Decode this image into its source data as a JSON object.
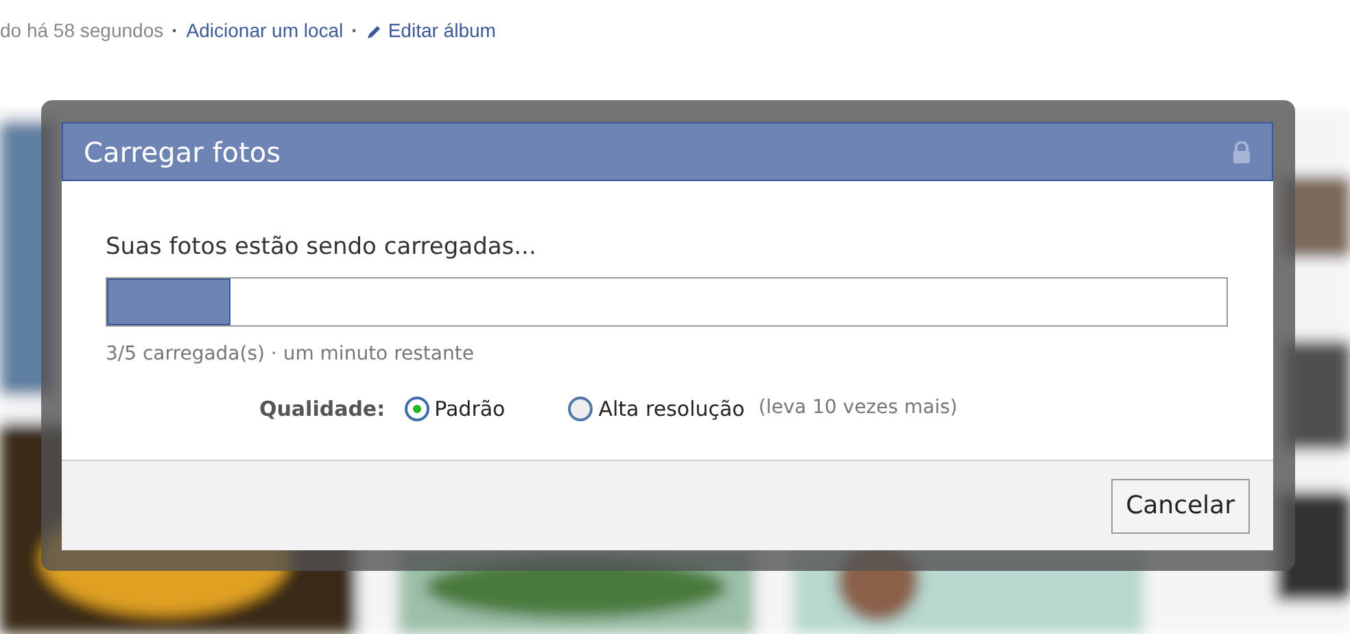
{
  "page_meta": [
    {
      "kind": "text",
      "text": "do há 58 segundos"
    },
    {
      "kind": "separator",
      "text": "·"
    },
    {
      "kind": "link",
      "text": "Adicionar um local"
    },
    {
      "kind": "separator",
      "text": "·"
    },
    {
      "kind": "icon_link",
      "text": "Editar álbum"
    }
  ],
  "dialog": {
    "title": "Carregar fotos",
    "locked": true,
    "message": "Suas fotos estão sendo carregadas...",
    "progress": {
      "level": 0.11
    },
    "status": "3/5 carregada(s) · um minuto restante",
    "quality": {
      "label": "Qualidade:",
      "options": [
        {
          "label": "Padrão",
          "selected": true
        },
        {
          "label": "Alta resolução",
          "hint": "(leva 10 vezes mais)",
          "selected": false
        }
      ]
    },
    "buttons": [
      "Cancelar"
    ]
  }
}
